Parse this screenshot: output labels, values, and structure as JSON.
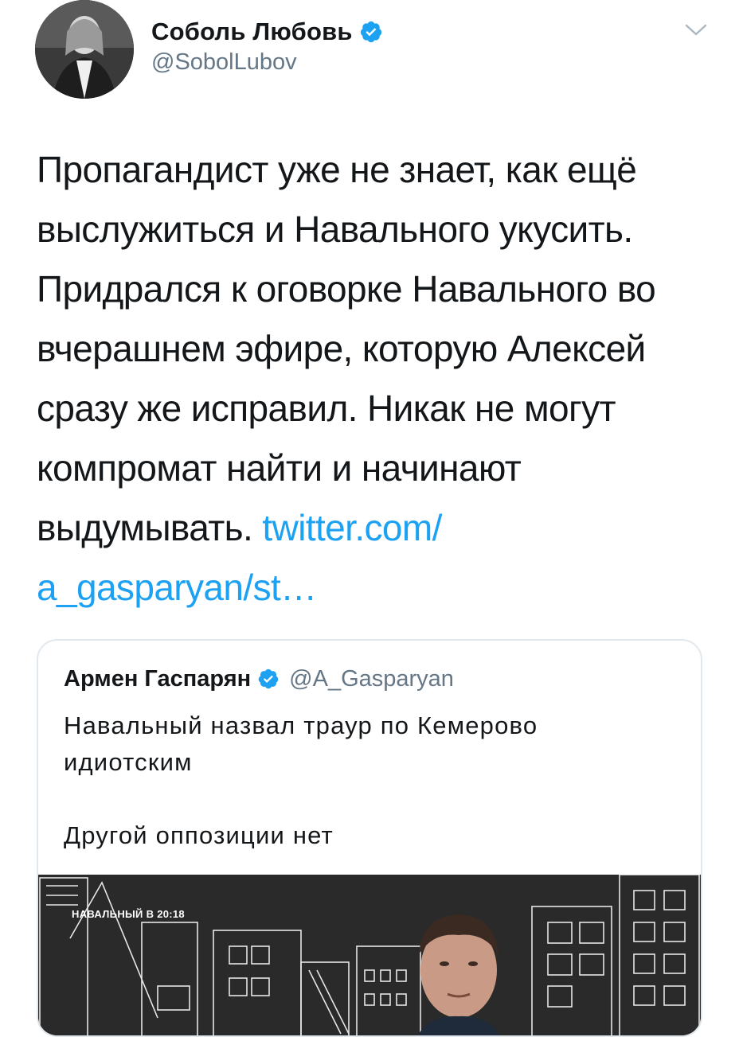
{
  "tweet": {
    "author_name": "Соболь Любовь",
    "author_handle": "@SobolLubov",
    "text_before_link": "Пропагандист уже не знает, как ещё выслужиться и Навального укусить. Придрался к оговорке Навального во вчерашнем эфире, которую Алексей сразу же исправил. Никак не могут компромат найти и начинают выдумывать. ",
    "link_text": "twitter.com/ a_gasparyan/st…"
  },
  "quoted_tweet": {
    "author_name": "Армен Гаспарян",
    "author_handle": "@A_Gasparyan",
    "text_line1": "Навальный назвал траур по Кемерово идиотским",
    "text_line2": "Другой оппозиции нет",
    "media_caption": "НАВАЛЬНЫЙ В 20:18"
  },
  "colors": {
    "link": "#1da1f2",
    "verified": "#1da1f2",
    "secondary_text": "#657786",
    "border": "#e1e8ed"
  },
  "icons": {
    "verified": "verified-badge-icon",
    "menu": "chevron-down-icon"
  }
}
